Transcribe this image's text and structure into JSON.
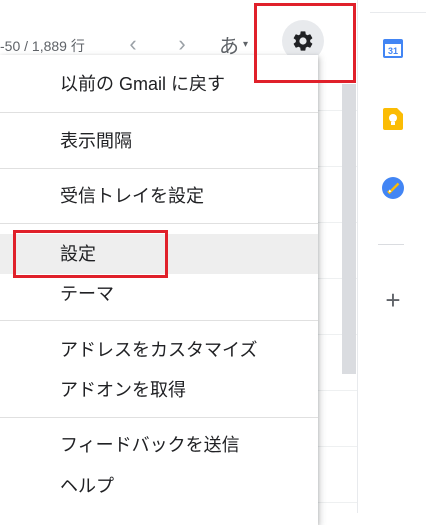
{
  "toolbar": {
    "pager_text": "-50 / 1,889 行",
    "prev_glyph": "‹",
    "next_glyph": "›",
    "ime_char": "あ",
    "ime_caret": "▾"
  },
  "menu": {
    "items": [
      {
        "label": "以前の Gmail に戻す"
      },
      {
        "label": "表示間隔"
      },
      {
        "label": "受信トレイを設定"
      },
      {
        "label": "設定",
        "highlighted": true
      },
      {
        "label": "テーマ"
      },
      {
        "label": "アドレスをカスタマイズ"
      },
      {
        "label": "アドオンを取得"
      },
      {
        "label": "フィードバックを送信"
      },
      {
        "label": "ヘルプ"
      }
    ]
  },
  "side_panel": {
    "calendar_day": "31",
    "apps": [
      "calendar-icon",
      "keep-icon",
      "tasks-icon"
    ],
    "add_glyph": "+"
  },
  "colors": {
    "highlight_box": "#e0202a",
    "calendar_blue": "#4285f4",
    "keep_yellow": "#fbbc04",
    "tasks_blue": "#4285f4"
  }
}
